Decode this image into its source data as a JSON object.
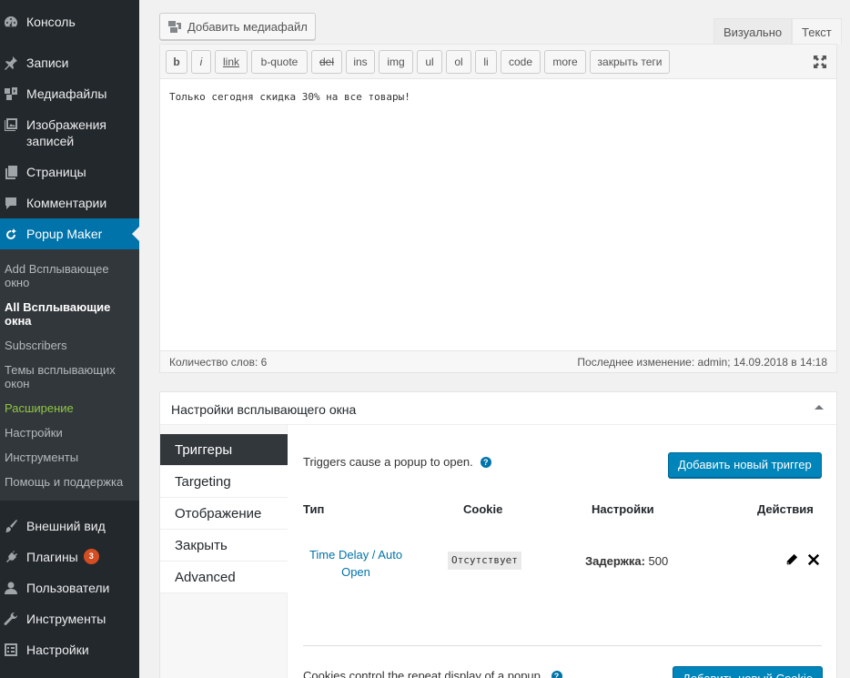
{
  "sidebar": {
    "menu_top": [
      {
        "label": "Консоль",
        "icon": "dashboard-icon"
      },
      {
        "label": "Записи",
        "icon": "pin-icon"
      },
      {
        "label": "Медиафайлы",
        "icon": "media-icon"
      },
      {
        "label": "Изображения записей",
        "icon": "images-icon"
      },
      {
        "label": "Страницы",
        "icon": "pages-icon"
      },
      {
        "label": "Комментарии",
        "icon": "comments-icon"
      },
      {
        "label": "Popup Maker",
        "icon": "popup-maker-icon"
      }
    ],
    "submenu": [
      {
        "label": "Add Всплывающее окно"
      },
      {
        "label": "All Всплывающие окна"
      },
      {
        "label": "Subscribers"
      },
      {
        "label": "Темы всплывающих окон"
      },
      {
        "label": "Расширение"
      },
      {
        "label": "Настройки"
      },
      {
        "label": "Инструменты"
      },
      {
        "label": "Помощь и поддержка"
      }
    ],
    "menu_bottom": [
      {
        "label": "Внешний вид",
        "icon": "appearance-icon"
      },
      {
        "label": "Плагины",
        "icon": "plugins-icon",
        "badge": "3"
      },
      {
        "label": "Пользователи",
        "icon": "users-icon"
      },
      {
        "label": "Инструменты",
        "icon": "tools-icon"
      },
      {
        "label": "Настройки",
        "icon": "settings-icon"
      }
    ]
  },
  "editor": {
    "add_media_label": "Добавить медиафайл",
    "tabs": [
      "Визуально",
      "Текст"
    ],
    "active_tab": "Текст",
    "quicktags": [
      "b",
      "i",
      "link",
      "b-quote",
      "del",
      "ins",
      "img",
      "ul",
      "ol",
      "li",
      "code",
      "more",
      "закрыть теги"
    ],
    "content": "Только сегодня скидка 30% на все товары!",
    "word_count": "Количество слов: 6",
    "last_edit": "Последнее изменение: admin; 14.09.2018 в 14:18"
  },
  "metabox": {
    "title": "Настройки всплывающего окна",
    "tabs": [
      "Триггеры",
      "Targeting",
      "Отображение",
      "Закрыть",
      "Advanced"
    ],
    "active_tab": "Триггеры",
    "triggers_desc": "Triggers cause a popup to open.",
    "add_trigger_label": "Добавить новый триггер",
    "columns": {
      "type": "Тип",
      "cookie": "Cookie",
      "settings": "Настройки",
      "actions": "Действия"
    },
    "row": {
      "type": "Time Delay / Auto Open",
      "cookie": "Отсутствует",
      "settings_label": "Задержка:",
      "settings_value": "500"
    },
    "cookies_desc": "Cookies control the repeat display of a popup.",
    "add_cookie_label": "Добавить новый Cookie"
  },
  "colors": {
    "sidebar_bg": "#23282d",
    "submenu_bg": "#32373c",
    "accent": "#0073aa",
    "button": "#0085ba",
    "badge": "#d54e21",
    "green": "#8ec641"
  }
}
